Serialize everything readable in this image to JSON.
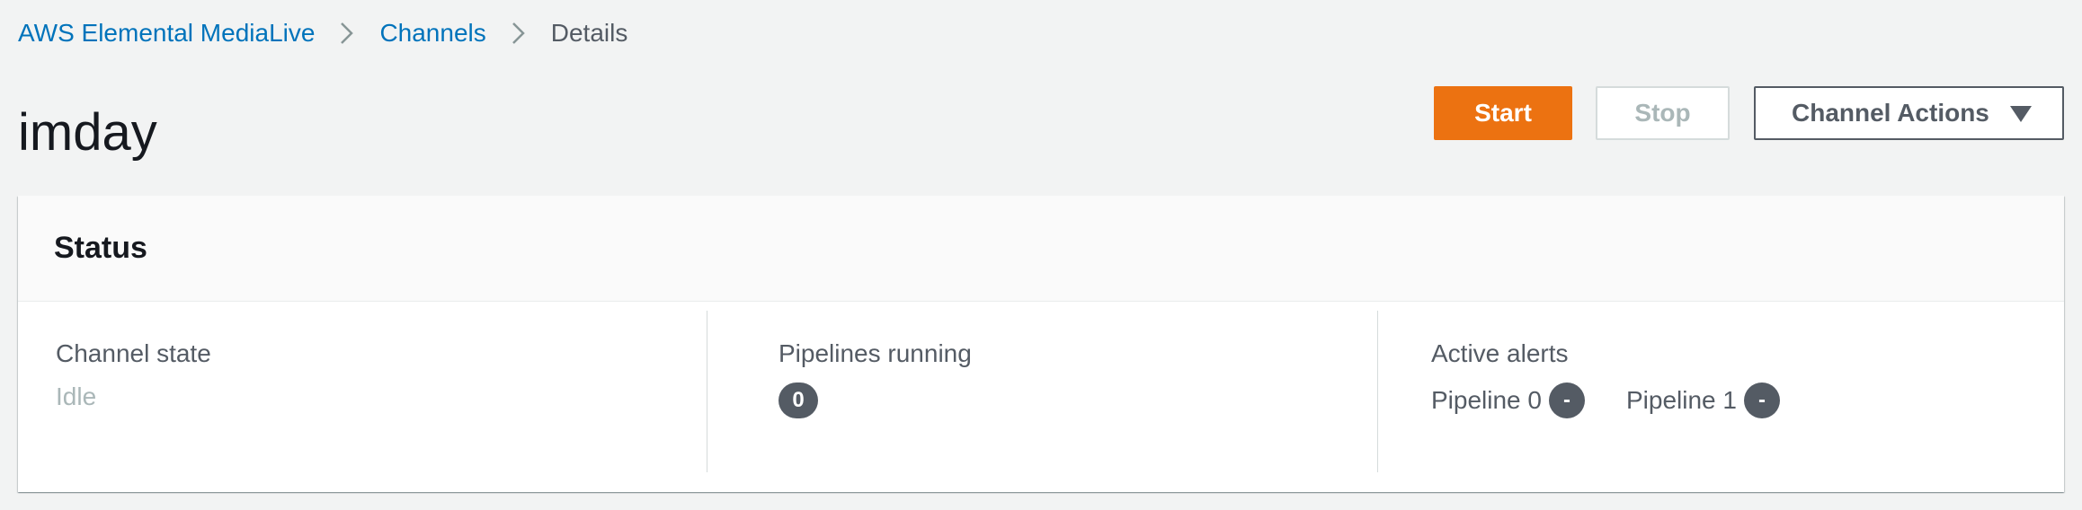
{
  "breadcrumb": {
    "items": [
      {
        "label": "AWS Elemental MediaLive"
      },
      {
        "label": "Channels"
      },
      {
        "label": "Details"
      }
    ]
  },
  "page": {
    "title": "imday"
  },
  "actions": {
    "start_label": "Start",
    "stop_label": "Stop",
    "channel_actions_label": "Channel Actions"
  },
  "status": {
    "title": "Status",
    "channel_state": {
      "label": "Channel state",
      "value": "Idle"
    },
    "pipelines_running": {
      "label": "Pipelines running",
      "value": "0"
    },
    "active_alerts": {
      "label": "Active alerts",
      "pipelines": [
        {
          "label": "Pipeline 0",
          "value": "-"
        },
        {
          "label": "Pipeline 1",
          "value": "-"
        }
      ]
    }
  },
  "colors": {
    "accent": "#ec7211",
    "link": "#0073bb",
    "background": "#f2f3f3",
    "badge": "#545b64"
  },
  "icons": {
    "breadcrumb_separator": "chevron-right-icon",
    "dropdown": "caret-down-icon"
  }
}
